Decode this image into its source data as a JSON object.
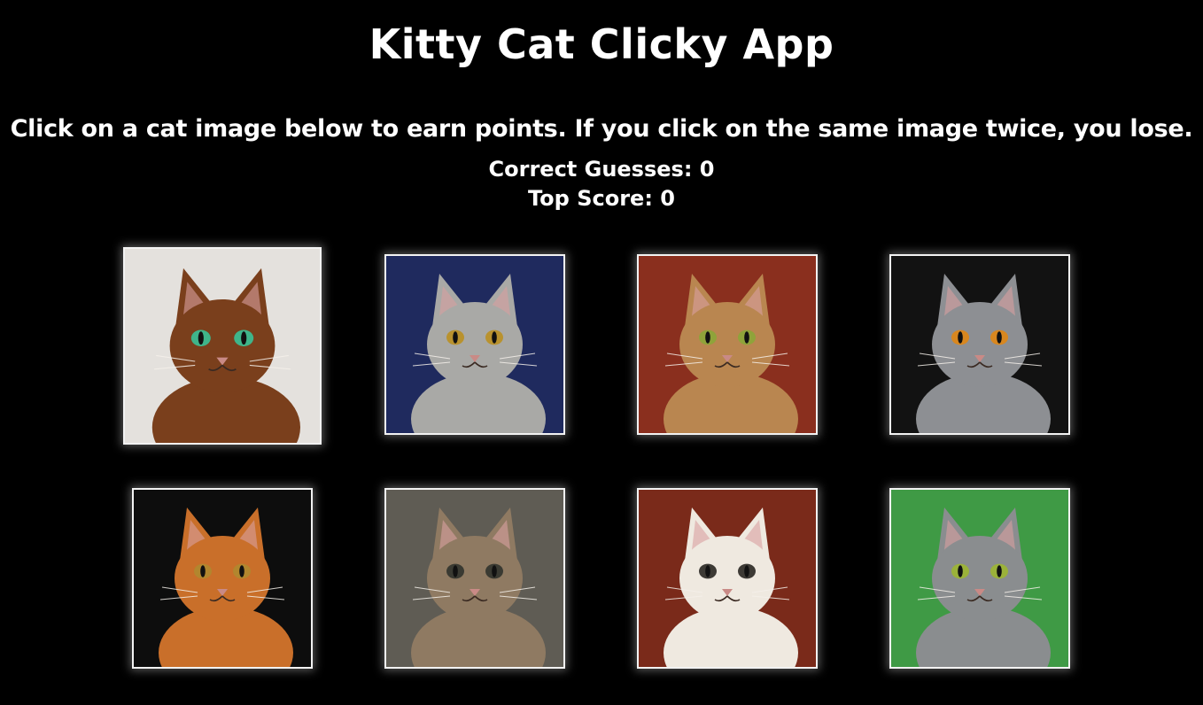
{
  "header": {
    "title": "Kitty Cat Clicky App",
    "instructions": "Click on a cat image below to earn points. If you click on the same image twice, you lose."
  },
  "scoreboard": {
    "correct_guesses": "Correct Guesses: 0",
    "top_score": "Top Score: 0"
  },
  "cards": [
    {
      "name": "abyssinian",
      "bg": "#e4e1dd",
      "fur": "#7a3f1c",
      "eye": "#3fb58a",
      "selected": true
    },
    {
      "name": "american-curl",
      "bg": "#1f2a5e",
      "fur": "#a9a9a6",
      "eye": "#b9922e"
    },
    {
      "name": "bengal",
      "bg": "#8a2f1e",
      "fur": "#b98650",
      "eye": "#8fa33a"
    },
    {
      "name": "british-shorthair",
      "bg": "#121212",
      "fur": "#8d8f93",
      "eye": "#d8871f"
    },
    {
      "name": "maine-coon",
      "bg": "#0d0d0d",
      "fur": "#c96f2a",
      "eye": "#b2862e"
    },
    {
      "name": "cuddling-tabbies",
      "bg": "#5f5c54",
      "fur": "#8f7a62",
      "eye": "#3a3a32"
    },
    {
      "name": "ragdoll",
      "bg": "#7a2a1a",
      "fur": "#efe9e0",
      "eye": "#3d3a35"
    },
    {
      "name": "russian-blue",
      "bg": "#3f9a45",
      "fur": "#8a8d8f",
      "eye": "#9bb23a"
    }
  ]
}
